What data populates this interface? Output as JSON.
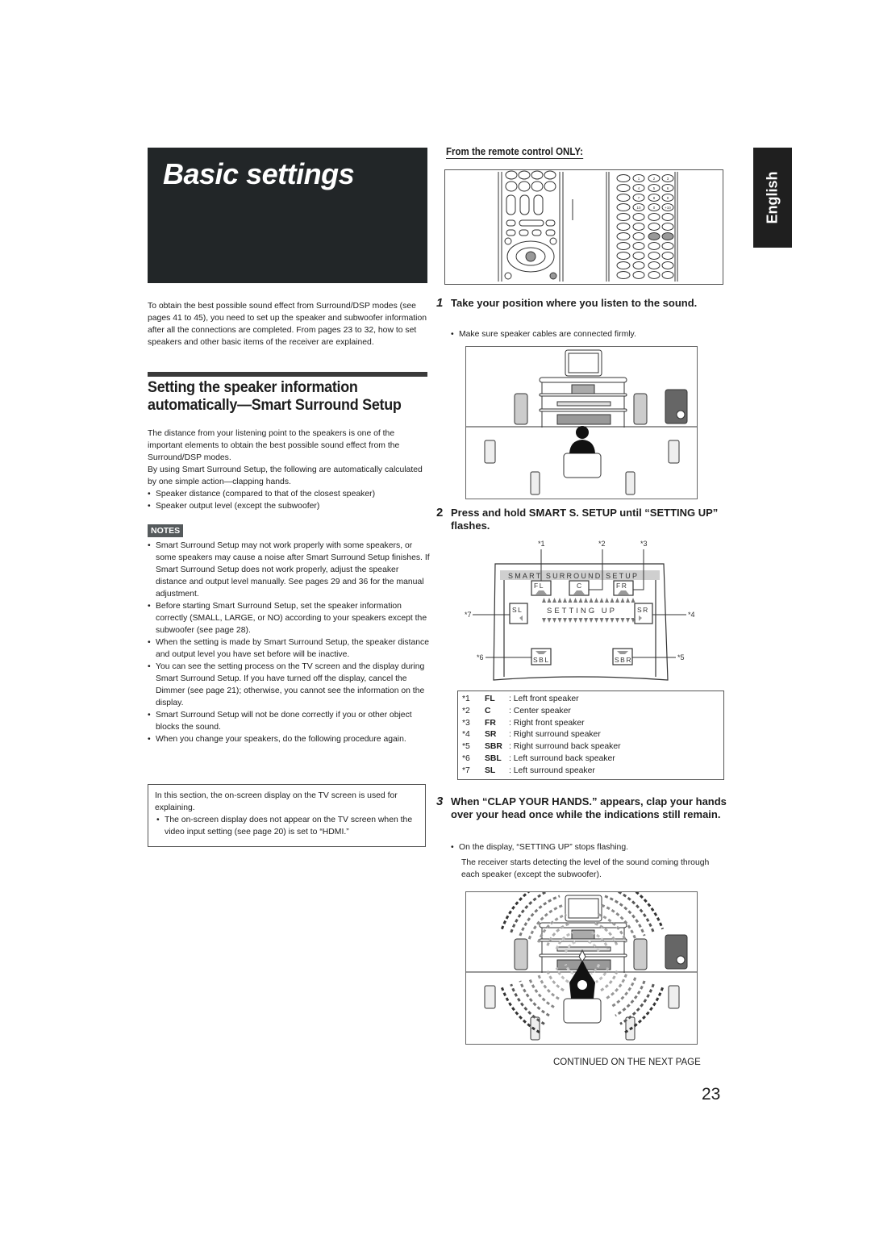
{
  "title": "Basic settings",
  "language_tab": "English",
  "intro": "To obtain the best possible sound effect from Surround/DSP modes (see pages 41 to 45), you need to set up the speaker and subwoofer information after all the connections are completed. From pages 23 to 32, how to set speakers and other basic items of the receiver are explained.",
  "section": {
    "heading": "Setting the speaker information automatically—Smart Surround Setup",
    "paragraph1": "The distance from your listening point to the speakers is one of the important elements to obtain the best possible sound effect from the Surround/DSP modes.",
    "paragraph2": "By using Smart Surround Setup, the following are automatically calculated by one simple action—clapping hands.",
    "bullets": [
      "Speaker distance (compared to that of the closest speaker)",
      "Speaker output level (except the subwoofer)"
    ]
  },
  "notes": {
    "label": "NOTES",
    "items": [
      "Smart Surround Setup may not work properly with some speakers, or some speakers may cause a noise after Smart Surround Setup finishes. If Smart Surround Setup does not work properly, adjust the speaker distance and output level manually. See pages 29 and 36 for the manual adjustment.",
      "Before starting Smart Surround Setup, set the speaker information correctly (SMALL, LARGE, or NO) according to your speakers except the subwoofer (see page 28).",
      "When the setting is made by Smart Surround Setup, the speaker distance and output level you have set before will be inactive.",
      "You can see the setting process on the TV screen and the display during Smart Surround Setup. If you have turned off the display, cancel the Dimmer (see page 21); otherwise, you cannot see the information on the display.",
      "Smart Surround Setup will not be done correctly if you or other object blocks the sound.",
      "When you change your speakers, do the following procedure again."
    ]
  },
  "note_box": {
    "text": "In this section, the on-screen display on the TV screen is used for explaining.",
    "bullet": "The on-screen display does not appear on the TV screen when the video input setting (see page 20) is set to “HDMI.”"
  },
  "remote": {
    "heading": "From the remote control ONLY:",
    "number_keys": [
      "1",
      "2",
      "3",
      "4",
      "5",
      "6",
      "7",
      "8",
      "9",
      "10",
      "0",
      "+10"
    ]
  },
  "steps": [
    {
      "number": "1",
      "text": "Take your position where you listen to the sound.",
      "bullet": "Make sure speaker cables are connected firmly."
    },
    {
      "number": "2",
      "text": "Press and hold SMART S. SETUP until “SETTING UP” flashes."
    },
    {
      "number": "3",
      "text": "When “CLAP YOUR HANDS.” appears, clap your hands over your head once while the indications still remain.",
      "bullet": "On the display, “SETTING UP” stops flashing.",
      "body": "The receiver starts detecting the level of the sound coming through each speaker (except the subwoofer)."
    }
  ],
  "osd": {
    "header": "SMART SURROUND SETUP",
    "status": "SETTING UP",
    "callouts": [
      "*1",
      "*2",
      "*3",
      "*4",
      "*5",
      "*6",
      "*7"
    ],
    "channels": {
      "fl": "FL",
      "c": "C",
      "fr": "FR",
      "sl": "SL",
      "sr": "SR",
      "sbl": "SBL",
      "sbr": "SBR"
    }
  },
  "legend": [
    {
      "num": "*1",
      "code": "FL",
      "desc": ": Left front speaker"
    },
    {
      "num": "*2",
      "code": "C",
      "desc": ": Center speaker"
    },
    {
      "num": "*3",
      "code": "FR",
      "desc": ": Right front speaker"
    },
    {
      "num": "*4",
      "code": "SR",
      "desc": ": Right surround speaker"
    },
    {
      "num": "*5",
      "code": "SBR",
      "desc": ": Right surround back speaker"
    },
    {
      "num": "*6",
      "code": "SBL",
      "desc": ": Left surround back speaker"
    },
    {
      "num": "*7",
      "code": "SL",
      "desc": ": Left surround speaker"
    }
  ],
  "footer": {
    "continued": "CONTINUED ON THE NEXT PAGE",
    "page_number": "23"
  },
  "colors": {
    "title_bg": "#222628",
    "tab_bg": "#1f1f1f",
    "notes_badge": "#555a5c",
    "osd_header": "#cccccc"
  }
}
